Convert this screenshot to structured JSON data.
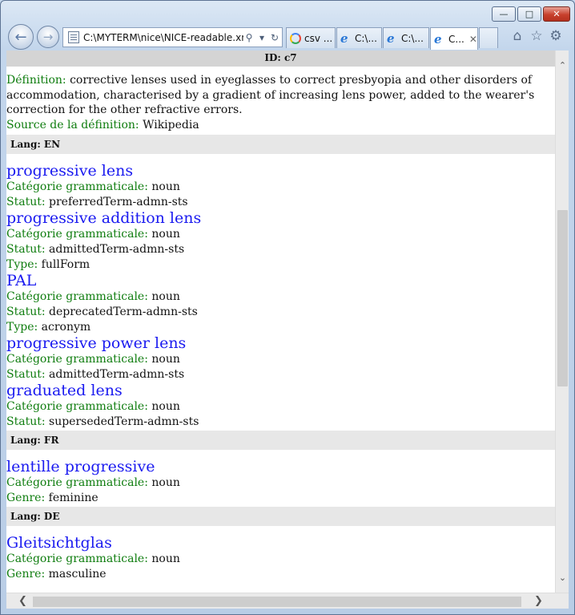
{
  "browser": {
    "address_url": "C:\\MYTERM\\nice\\NICE-readable.xml",
    "tabs": [
      {
        "label": "csv ...",
        "icon": "google-icon",
        "active": false
      },
      {
        "label": "C:\\...",
        "icon": "ie-icon",
        "active": false
      },
      {
        "label": "C:\\...",
        "icon": "ie-icon",
        "active": false
      },
      {
        "label": "C...",
        "icon": "ie-icon",
        "active": true
      }
    ]
  },
  "doc": {
    "id_label": "ID: c7",
    "definition_label": "Définition:",
    "definition_text": "corrective lenses used in eyeglasses to correct presbyopia and other disorders of accommodation, characterised by a gradient of increasing lens power, added to the wearer's correction for the other refractive errors.",
    "source_label": "Source de la définition:",
    "source_value": "Wikipedia",
    "field_labels": {
      "pos": "Catégorie grammaticale:",
      "status": "Statut:",
      "type": "Type:",
      "gender": "Genre:"
    },
    "langs": [
      {
        "header": "Lang: EN",
        "terms": [
          {
            "term": "progressive lens",
            "pos": "noun",
            "status": "preferredTerm-admn-sts"
          },
          {
            "term": "progressive addition lens",
            "pos": "noun",
            "status": "admittedTerm-admn-sts",
            "type": "fullForm"
          },
          {
            "term": "PAL",
            "pos": "noun",
            "status": "deprecatedTerm-admn-sts",
            "type": "acronym"
          },
          {
            "term": "progressive power lens",
            "pos": "noun",
            "status": "admittedTerm-admn-sts"
          },
          {
            "term": "graduated lens",
            "pos": "noun",
            "status": "supersededTerm-admn-sts"
          }
        ]
      },
      {
        "header": "Lang: FR",
        "terms": [
          {
            "term": "lentille progressive",
            "pos": "noun",
            "gender": "feminine"
          }
        ]
      },
      {
        "header": "Lang: DE",
        "terms": [
          {
            "term": "Gleitsichtglas",
            "pos": "noun",
            "gender": "masculine"
          }
        ]
      }
    ]
  }
}
